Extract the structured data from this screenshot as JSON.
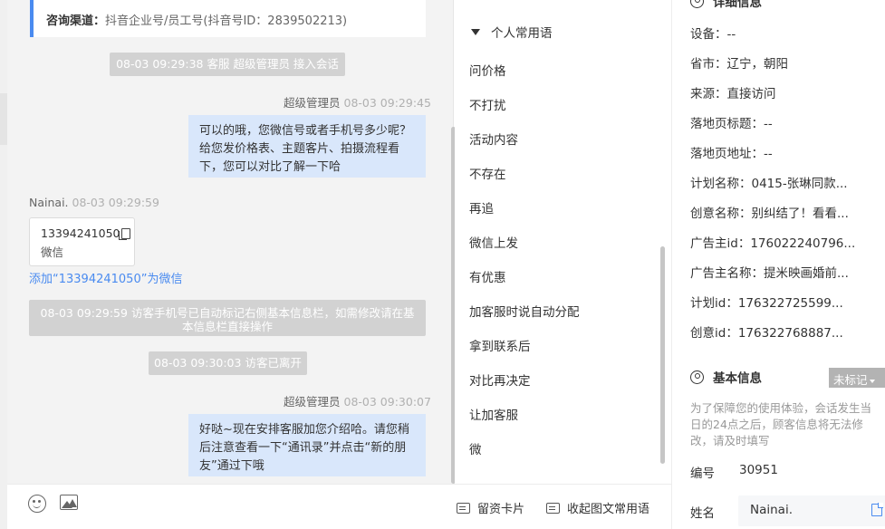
{
  "source": {
    "label": "咨询渠道：",
    "value": "抖音企业号/员工号(抖音号ID：2839502213)"
  },
  "chat": {
    "messages": {
      "sys1": "08-03 09:29:38 客服 超级管理员 接入会话",
      "agent1": {
        "name": "超级管理员",
        "time": "08-03 09:29:45",
        "text": "可以的哦，您微信号或者手机号多少呢？给您发价格表、主题客片、拍摄流程看下，您可以对比了解一下哈"
      },
      "visitor1": {
        "name": "Nainai.",
        "time": "08-03 09:29:59",
        "phone": "13394241050",
        "phone_sub": "微信",
        "add_link": "添加“13394241050”为微信"
      },
      "sys2": "08-03 09:29:59 访客手机号已自动标记右侧基本信息栏，如需修改请在基本信息栏直接操作",
      "sys3": "08-03 09:30:03 访客已离开",
      "agent2": {
        "name": "超级管理员",
        "time": "08-03 09:30:07",
        "text": "好哒~现在安排客服加您介绍哈。请您稍后注意查看一下“通讯录”并点击“新的朋友”通过下哦"
      }
    },
    "footer": {
      "lead_card": "留资卡片",
      "collapse": "收起图文常用语"
    }
  },
  "phrases": {
    "group": "个人常用语",
    "items": [
      "问价格",
      "不打扰",
      "活动内容",
      "不存在",
      "再追",
      "微信上发",
      "有优惠",
      "加客服时说自动分配",
      "拿到联系后",
      "对比再决定",
      "让加客服",
      "微"
    ]
  },
  "info": {
    "top_title": "详细信息",
    "rows": [
      "设备：--",
      "省市：辽宁，朝阳",
      "来源：直接访问",
      "落地页标题：--",
      "落地页地址：--",
      "计划名称：0415-张琳同款...",
      "创意名称：别纠结了！看看...",
      "广告主id：176022240796...",
      "广告主名称：提米映画婚前...",
      "计划id：176322725599...",
      "创意id：176322768887..."
    ],
    "basic": {
      "title": "基本信息",
      "mark": "未标记",
      "notice": "为了保障您的使用体验，会话发生当日的24点之后，顾客信息将无法修改，请及时填写",
      "id_label": "编号",
      "id_value": "30951",
      "name_label": "姓名",
      "name_value": "Nainai."
    }
  }
}
